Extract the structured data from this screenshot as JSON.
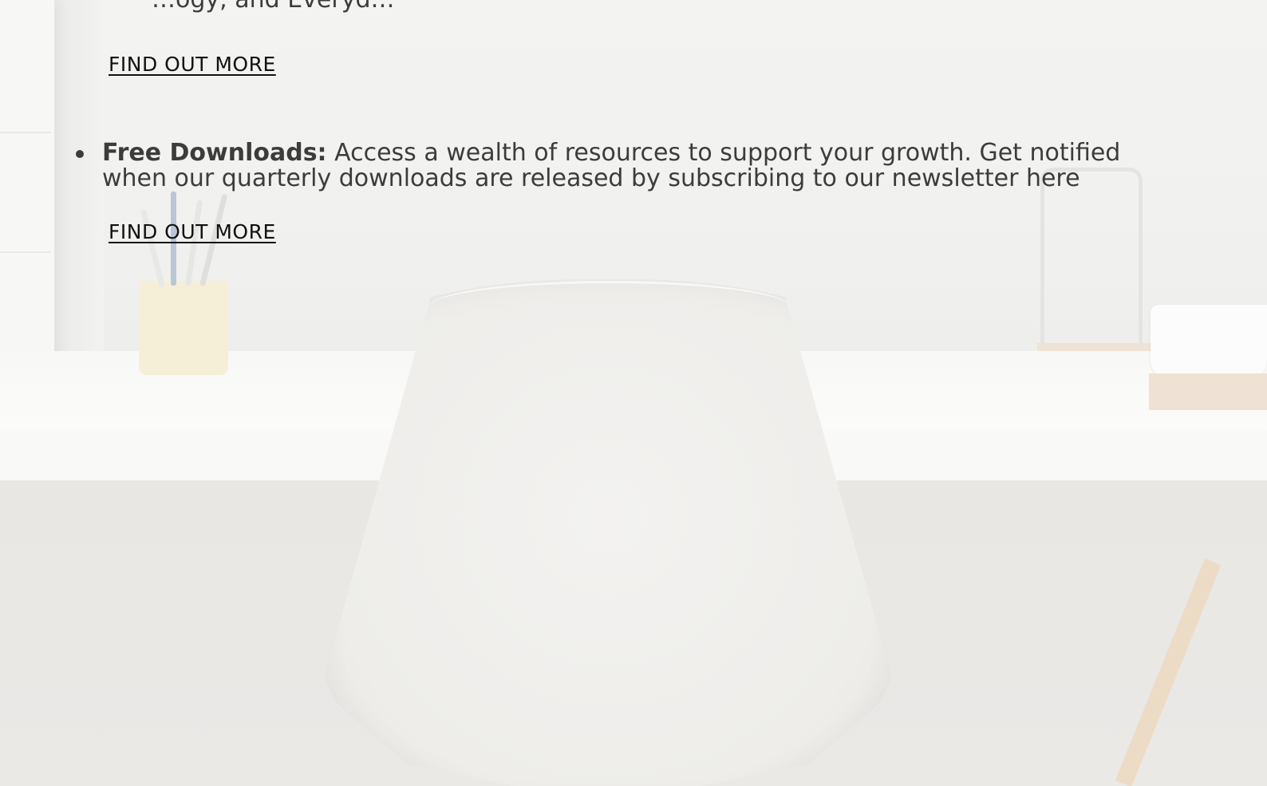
{
  "content": {
    "partial_top_text": "…ogy, and Everyd…",
    "link_1": "FIND OUT MORE",
    "feature": {
      "title": "Free Downloads:",
      "description": " Access a wealth of resources to support your growth. Get notified when our quarterly downloads are released by subscribing to our newsletter here"
    },
    "link_2": "FIND OUT MORE"
  },
  "colors": {
    "text": "#3c3c3c",
    "link": "#111111",
    "background": "#efeeec"
  }
}
